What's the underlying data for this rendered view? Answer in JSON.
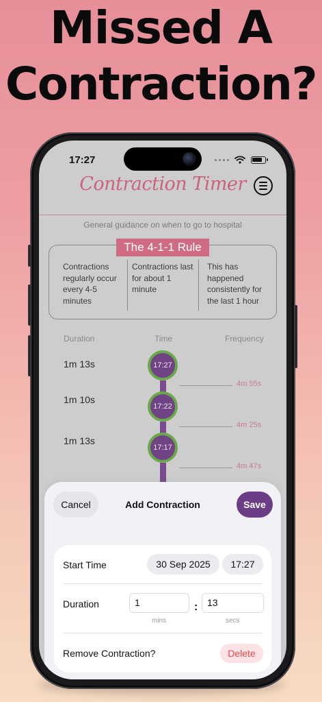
{
  "headline": {
    "line1": "Missed A",
    "line2": "Contraction?"
  },
  "status": {
    "time": "17:27"
  },
  "app": {
    "title": "Contraction Timer",
    "guidance": "General guidance on when to go to hospital"
  },
  "rule": {
    "badge": "The 4-1-1 Rule",
    "columns": [
      "Contractions regularly occur every 4-5 minutes",
      "Contractions last for about 1 minute",
      "This has happened consistently for the last 1 hour"
    ]
  },
  "timeline": {
    "headers": {
      "duration": "Duration",
      "time": "Time",
      "frequency": "Frequency"
    },
    "entries": [
      {
        "duration": "1m 13s",
        "time": "17:27",
        "frequency": "4m 55s"
      },
      {
        "duration": "1m 10s",
        "time": "17:22",
        "frequency": "4m 25s"
      },
      {
        "duration": "1m 13s",
        "time": "17:17",
        "frequency": "4m 47s"
      }
    ]
  },
  "sheet": {
    "cancel": "Cancel",
    "title": "Add Contraction",
    "save": "Save",
    "start_time_label": "Start Time",
    "start_date": "30 Sep 2025",
    "start_time": "17:27",
    "duration_label": "Duration",
    "minutes_value": "1",
    "seconds_value": "13",
    "separator": ":",
    "minutes_unit": "mins",
    "seconds_unit": "secs",
    "remove_label": "Remove Contraction?",
    "delete": "Delete"
  },
  "colors": {
    "accent_pink": "#cf6c83",
    "accent_purple": "#6b3d86",
    "ring_green": "#69a94b",
    "delete_red": "#e5484d"
  }
}
